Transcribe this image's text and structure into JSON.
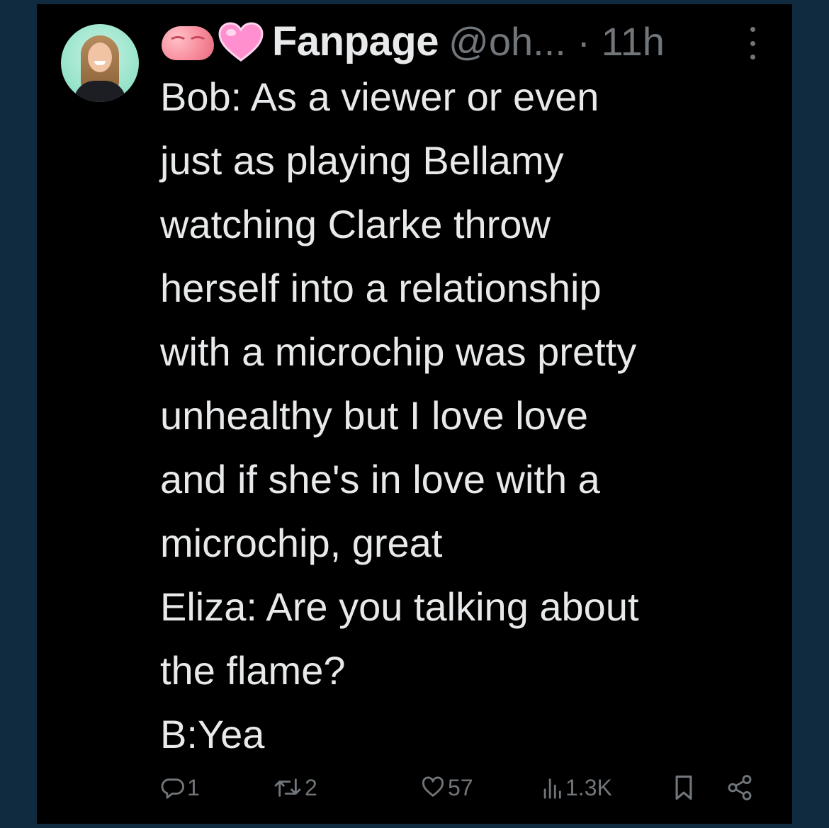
{
  "tweet": {
    "author_name": "Fanpage",
    "handle_time": "@oh... · 11h",
    "lines": [
      "Bob: As a viewer or even",
      "just as playing Bellamy",
      "watching Clarke throw",
      "herself into a relationship",
      "with a microchip was pretty",
      "unhealthy but I love love",
      "and if she's in love with a",
      "microchip, great",
      "Eliza: Are you talking about",
      "the flame?",
      "B:Yea"
    ],
    "name_emojis": [
      "brain-emoji",
      "pink-heart-emoji"
    ]
  },
  "actions": {
    "replies": "1",
    "reposts": "2",
    "likes": "57",
    "views": "1.3K"
  },
  "icons": {
    "reply": "reply-icon",
    "repost": "repost-icon",
    "like": "heart-icon",
    "views": "views-chart-icon",
    "bookmark": "bookmark-icon",
    "share": "share-icon",
    "more": "more-dots-icon"
  },
  "colors": {
    "background": "#102a3f",
    "card": "#000000",
    "text": "#e7e9ea",
    "muted": "#71767b"
  }
}
